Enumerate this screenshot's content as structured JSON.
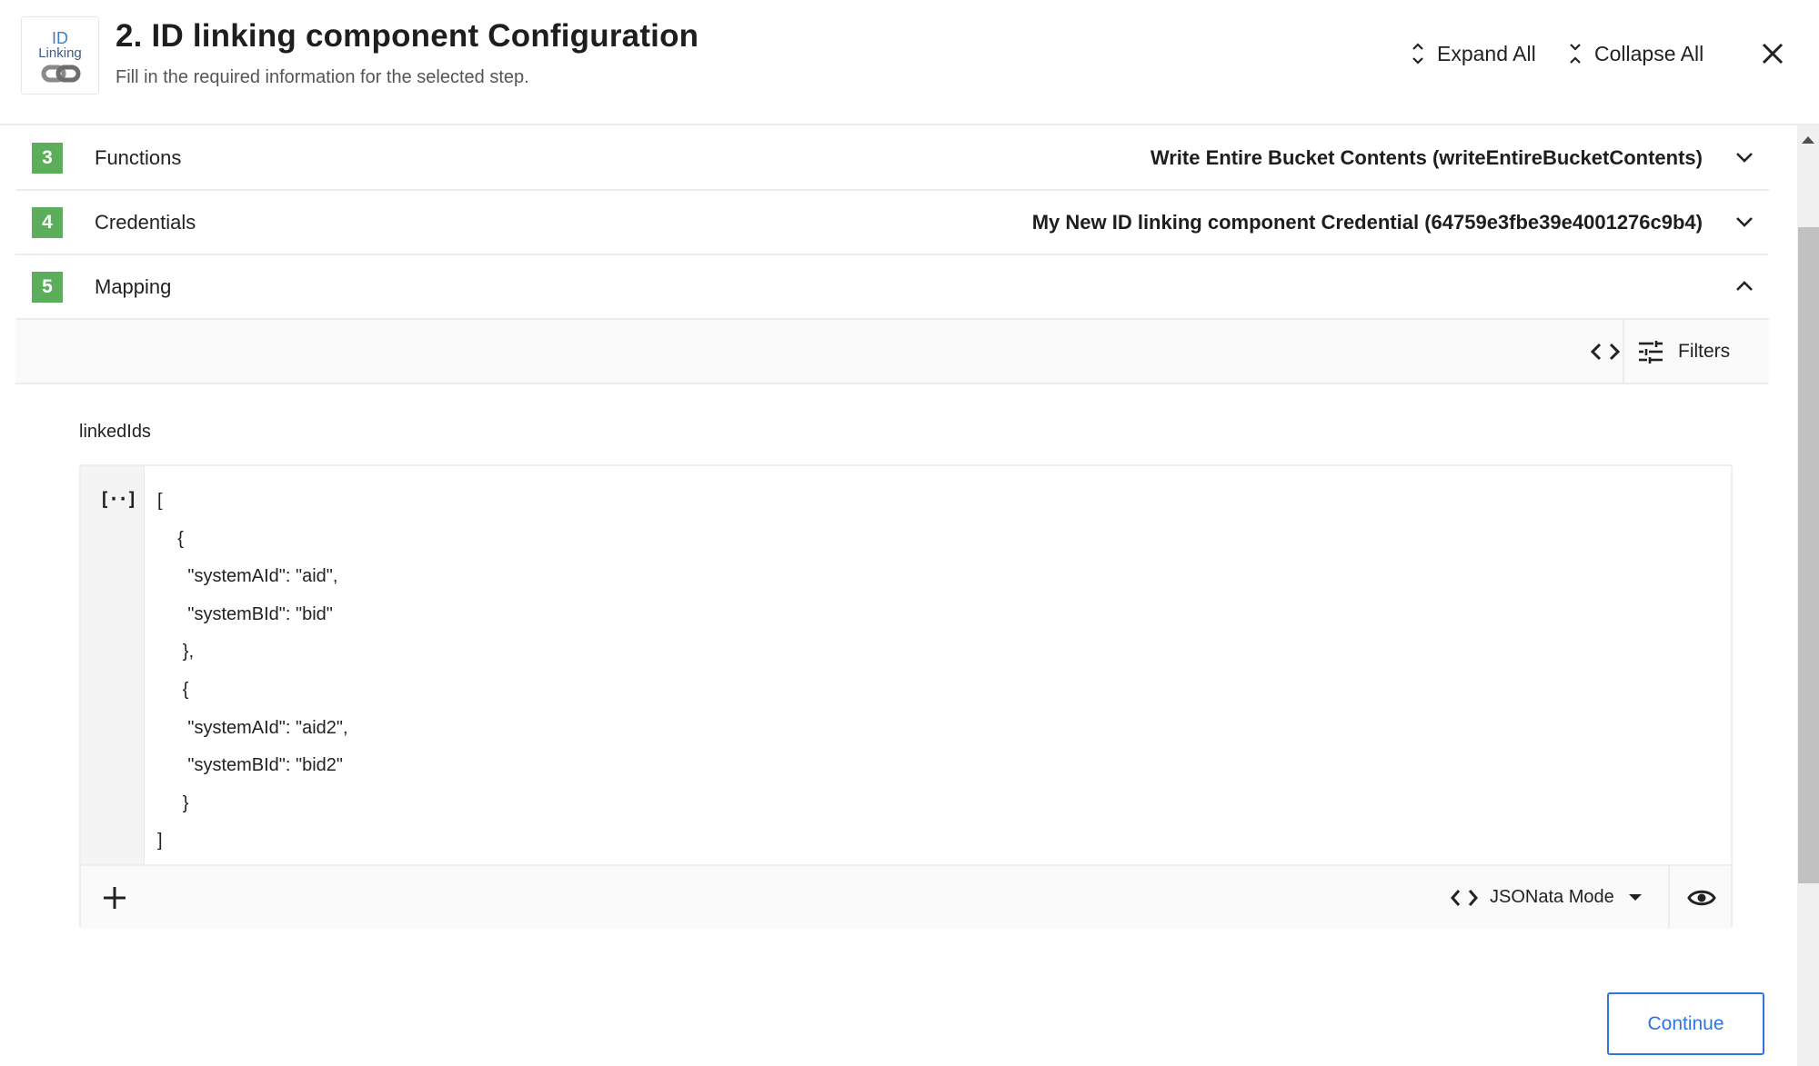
{
  "header": {
    "logo": {
      "line1": "ID",
      "line2": "Linking",
      "icon": "chain-link-icon"
    },
    "title": "2. ID linking component Configuration",
    "subtitle": "Fill in the required information for the selected step.",
    "expand_all_label": "Expand All",
    "collapse_all_label": "Collapse All",
    "close_icon": "close-icon"
  },
  "steps": [
    {
      "number": "3",
      "label": "Functions",
      "value": "Write Entire Bucket Contents (writeEntireBucketContents)",
      "state": "collapsed"
    },
    {
      "number": "4",
      "label": "Credentials",
      "value": "My New ID linking component Credential (64759e3fbe39e4001276c9b4)",
      "state": "collapsed"
    },
    {
      "number": "5",
      "label": "Mapping",
      "value": "",
      "state": "expanded"
    }
  ],
  "mapping": {
    "toolbar": {
      "code_icon": "code-brackets-icon",
      "filters_label": "Filters",
      "filters_icon": "sliders-icon"
    },
    "field": {
      "label": "linkedIds",
      "gutter_icon_text": "[··]",
      "code_lines": [
        "[",
        "    {",
        "      \"systemAId\": \"aid\",",
        "      \"systemBId\": \"bid\"",
        "     },",
        "     {",
        "      \"systemAId\": \"aid2\",",
        "      \"systemBId\": \"bid2\"",
        "     }",
        "]"
      ],
      "mode_label": "JSONata Mode",
      "add_icon": "plus-icon",
      "preview_icon": "eye-icon"
    }
  },
  "actions": {
    "continue_label": "Continue"
  },
  "colors": {
    "badge": "#5cad5c",
    "accent": "#2f74e0"
  }
}
